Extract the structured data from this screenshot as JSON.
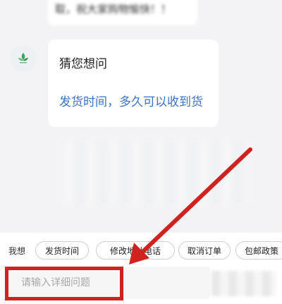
{
  "chat": {
    "previous_message": "取，祝大家购物愉快！！",
    "guess_title": "猜您想问",
    "guess_link": "发货时间，多久可以收到货"
  },
  "quick_replies": {
    "prefix": "我想",
    "chips": [
      "发货时间",
      "修改地址电话",
      "取消订单",
      "包邮政策"
    ]
  },
  "input": {
    "placeholder": "请输入详细问题",
    "value": ""
  },
  "annotation": {
    "color": "#d0231f"
  }
}
